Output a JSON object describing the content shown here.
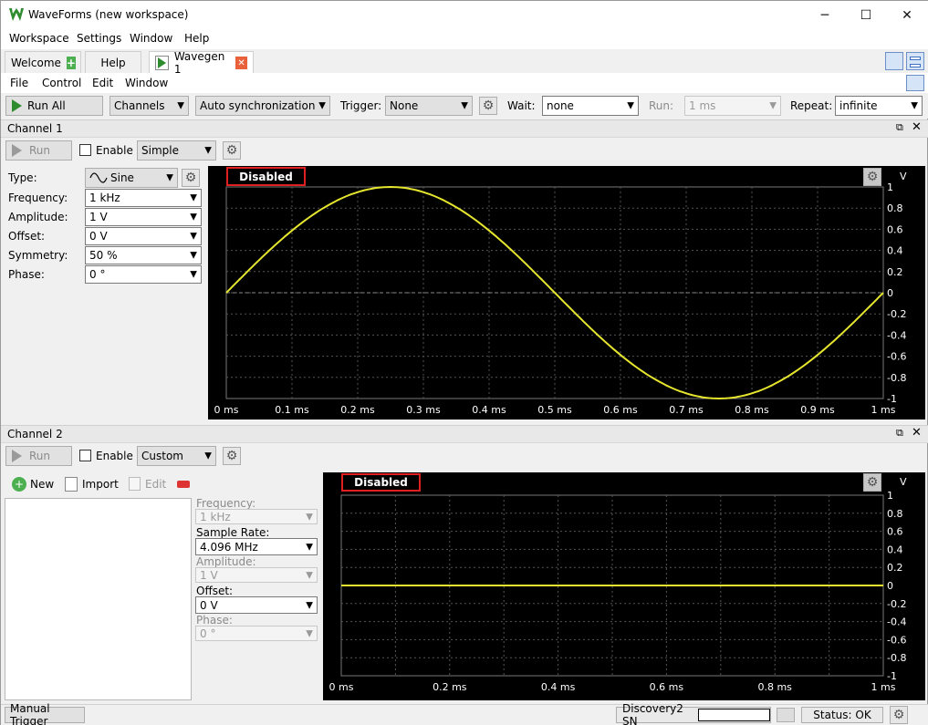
{
  "window": {
    "title": "WaveForms (new workspace)",
    "minimize": "─",
    "maximize": "☐",
    "close": "✕"
  },
  "menu": [
    "Workspace",
    "Settings",
    "Window",
    "Help"
  ],
  "tabs": {
    "welcome": "Welcome",
    "help": "Help",
    "wavegen": "Wavegen 1"
  },
  "submenu": [
    "File",
    "Control",
    "Edit",
    "Window"
  ],
  "toolbar": {
    "run_all": "Run All",
    "channels": "Channels",
    "sync": "Auto synchronization",
    "trigger_label": "Trigger:",
    "trigger_value": "None",
    "wait_label": "Wait:",
    "wait_value": "none",
    "run_label": "Run:",
    "run_value": "1 ms",
    "repeat_label": "Repeat:",
    "repeat_value": "infinite"
  },
  "channel1": {
    "header": "Channel 1",
    "run": "Run",
    "enable": "Enable",
    "mode": "Simple",
    "fields": {
      "type_label": "Type:",
      "type_value": "Sine",
      "freq_label": "Frequency:",
      "freq_value": "1 kHz",
      "amp_label": "Amplitude:",
      "amp_value": "1 V",
      "offset_label": "Offset:",
      "offset_value": "0 V",
      "sym_label": "Symmetry:",
      "sym_value": "50 %",
      "phase_label": "Phase:",
      "phase_value": "0 °"
    },
    "plot": {
      "badge": "Disabled",
      "unit": "V",
      "y_ticks": [
        "1",
        "0.8",
        "0.6",
        "0.4",
        "0.2",
        "0",
        "-0.2",
        "-0.4",
        "-0.6",
        "-0.8",
        "-1"
      ],
      "x_ticks": [
        "0 ms",
        "0.1 ms",
        "0.2 ms",
        "0.3 ms",
        "0.4 ms",
        "0.5 ms",
        "0.6 ms",
        "0.7 ms",
        "0.8 ms",
        "0.9 ms",
        "1 ms"
      ],
      "trace_color": "#e6e62e"
    }
  },
  "channel2": {
    "header": "Channel 2",
    "run": "Run",
    "enable": "Enable",
    "mode": "Custom",
    "actions": {
      "new": "New",
      "import": "Import",
      "edit": "Edit"
    },
    "fields": {
      "freq_label": "Frequency:",
      "freq_value": "1 kHz",
      "rate_label": "Sample Rate:",
      "rate_value": "4.096 MHz",
      "amp_label": "Amplitude:",
      "amp_value": "1 V",
      "offset_label": "Offset:",
      "offset_value": "0 V",
      "phase_label": "Phase:",
      "phase_value": "0 °"
    },
    "plot": {
      "badge": "Disabled",
      "unit": "V",
      "y_ticks": [
        "1",
        "0.8",
        "0.6",
        "0.4",
        "0.2",
        "0",
        "-0.2",
        "-0.4",
        "-0.6",
        "-0.8",
        "-1"
      ],
      "x_ticks": [
        "0 ms",
        "0.2 ms",
        "0.4 ms",
        "0.6 ms",
        "0.8 ms",
        "1 ms"
      ],
      "trace_color": "#e6e62e"
    }
  },
  "status": {
    "manual_trigger": "Manual Trigger",
    "device": "Discovery2 SN",
    "status": "Status: OK"
  },
  "colors": {
    "accent_green": "#2e8b2e",
    "badge_border": "#e02020",
    "plot_bg": "#000000"
  }
}
